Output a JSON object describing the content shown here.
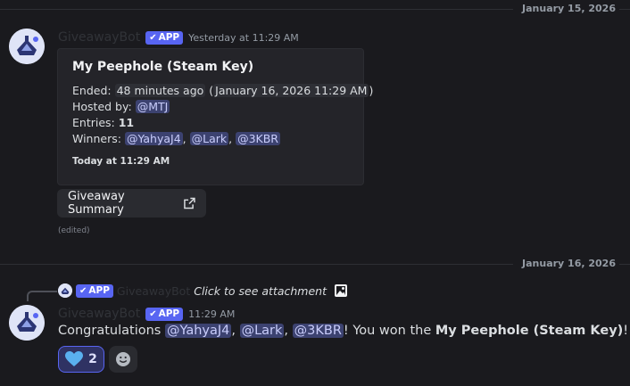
{
  "colors": {
    "accent": "#5865f2",
    "mention_bg": "#3c4270",
    "background": "#1a1a1e"
  },
  "dividers": [
    {
      "date": "January 15, 2026"
    },
    {
      "date": "January 16, 2026"
    }
  ],
  "message1": {
    "username": "GiveawayBot",
    "badge": "APP",
    "timestamp": "Yesterday at 11:29 AM",
    "embed": {
      "title": "My Peephole (Steam Key)",
      "ended_label": "Ended:",
      "ended_relative": "48 minutes ago",
      "ended_absolute": "January 16, 2026 11:29 AM",
      "hosted_label": "Hosted by:",
      "host": "@MTJ",
      "entries_label": "Entries:",
      "entries": "11",
      "winners_label": "Winners:",
      "winners": [
        "@YahyaJ4",
        "@Lark",
        "@3KBR"
      ],
      "footer": "Today at 11:29 AM"
    },
    "link_button": "Giveaway Summary",
    "edited": "(edited)"
  },
  "message2": {
    "reply": {
      "badge": "APP",
      "username": "GiveawayBot",
      "text": "Click to see attachment"
    },
    "username": "GiveawayBot",
    "badge": "APP",
    "timestamp": "11:29 AM",
    "text_prefix": "Congratulations",
    "mentions": [
      "@YahyaJ4",
      "@Lark",
      "@3KBR"
    ],
    "text_middle": "! You won the",
    "prize": "My Peephole (Steam Key)",
    "text_suffix": "!",
    "reaction": {
      "emoji": "blue-heart-icon",
      "count": "2"
    },
    "add_reaction_icon": "smiley-icon"
  }
}
